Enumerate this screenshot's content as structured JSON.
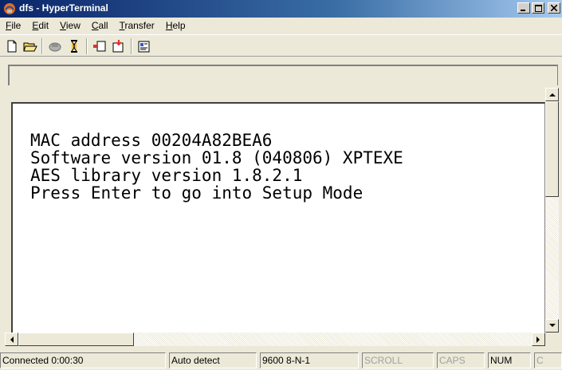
{
  "window": {
    "title": "dfs - HyperTerminal"
  },
  "menu": [
    {
      "label": "File",
      "mn": "F",
      "rest": "ile"
    },
    {
      "label": "Edit",
      "mn": "E",
      "rest": "dit"
    },
    {
      "label": "View",
      "mn": "V",
      "rest": "iew"
    },
    {
      "label": "Call",
      "mn": "C",
      "rest": "all"
    },
    {
      "label": "Transfer",
      "mn": "T",
      "rest": "ransfer"
    },
    {
      "label": "Help",
      "mn": "H",
      "rest": "elp"
    }
  ],
  "toolbar": {
    "icons": [
      "new-icon",
      "open-icon",
      "connect-icon",
      "disconnect-icon",
      "send-icon",
      "receive-icon",
      "properties-icon"
    ]
  },
  "terminal": {
    "lines": [
      "MAC address 00204A82BEA6",
      "Software version 01.8 (040806) XPTEXE",
      "AES library version 1.8.2.1",
      "Press Enter to go into Setup Mode"
    ]
  },
  "status": {
    "connected": "Connected 0:00:30",
    "detect": "Auto detect",
    "settings": "9600 8-N-1",
    "scroll": "SCROLL",
    "caps": "CAPS",
    "num": "NUM",
    "capture": "C"
  },
  "colors": {
    "titlebar": "#0A246A",
    "chrome": "#ECE9D8",
    "terminal_bg": "#FFFFFF"
  }
}
